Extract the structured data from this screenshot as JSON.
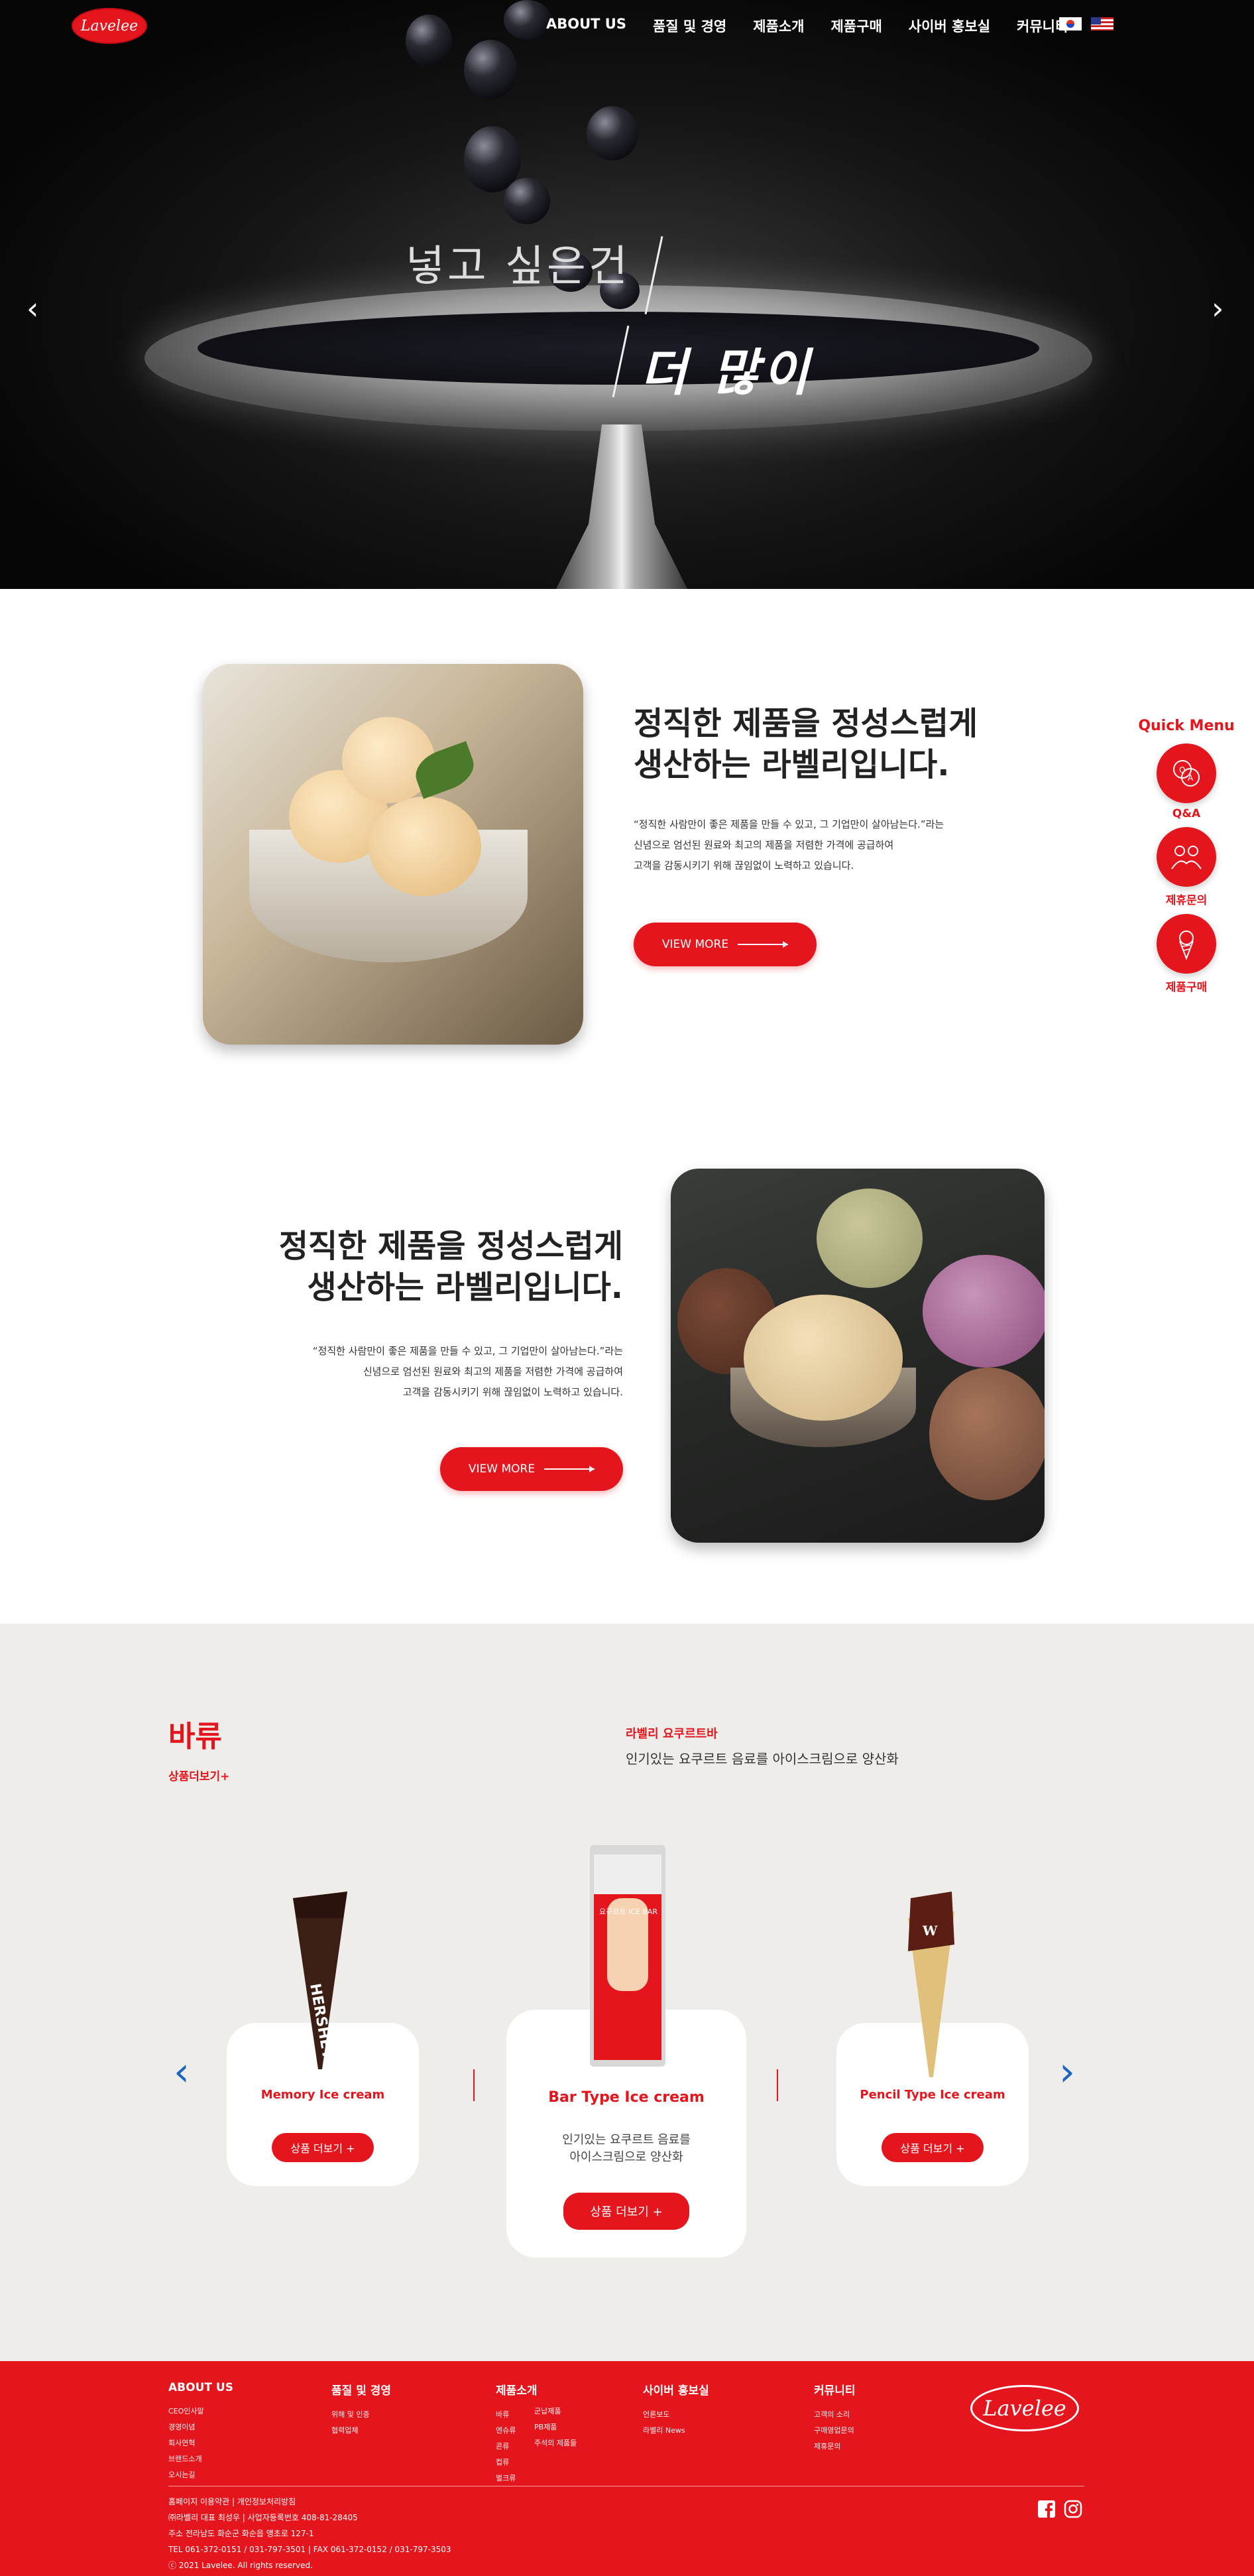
{
  "header": {
    "logo": "Lavelee",
    "nav": [
      "ABOUT US",
      "품질 및 경영",
      "제품소개",
      "제품구매",
      "사이버 홍보실",
      "커뮤니티"
    ],
    "flags": [
      "kr-flag-icon",
      "us-flag-icon"
    ]
  },
  "hero": {
    "line1": "넣고 싶은건",
    "line2": "더 많이",
    "prev_icon": "chevron-left-icon",
    "next_icon": "chevron-right-icon"
  },
  "intro1": {
    "title_l1": "정직한 제품을 정성스럽게",
    "title_l2": "생산하는 라벨리입니다.",
    "desc_l1": "“정직한 사람만이 좋은 제품을 만들 수 있고, 그 기업만이 살아남는다.”라는",
    "desc_l2": "신념으로 엄선된 원료와 최고의 제품을 저렴한 가격에 공급하여",
    "desc_l3": "고객을 감동시키기 위해 끊임없이 노력하고 있습니다.",
    "button": "VIEW MORE"
  },
  "intro2": {
    "title_l1": "정직한 제품을 정성스럽게",
    "title_l2": "생산하는 라벨리입니다.",
    "desc_l1": "“정직한 사람만이 좋은 제품을 만들 수 있고, 그 기업만이 살아남는다.”라는",
    "desc_l2": "신념으로 엄선된 원료와 최고의 제품을 저렴한 가격에 공급하여",
    "desc_l3": "고객을 감동시키기 위해 끊임없이 노력하고 있습니다.",
    "button": "VIEW MORE"
  },
  "quick_menu": {
    "title": "Quick Menu",
    "items": [
      {
        "label": "Q&A",
        "icon": "qa-icon"
      },
      {
        "label": "제휴문의",
        "icon": "partnership-icon"
      },
      {
        "label": "제품구매",
        "icon": "ice-cream-icon"
      }
    ]
  },
  "products": {
    "brand": "바류",
    "more": "상품더보기+",
    "featured_name": "라벨리 요쿠르트바",
    "featured_desc": "인기있는 요쿠르트 음료를 아이스크림으로 양산화",
    "cards": [
      {
        "name": "Memory Ice cream",
        "button": "상품 더보기 +"
      },
      {
        "name": "Bar Type Ice cream",
        "desc_l1": "인기있는 요쿠르트 음료를",
        "desc_l2": "아이스크림으로 양산화",
        "button": "상품 더보기 +"
      },
      {
        "name": "Pencil Type Ice cream",
        "button": "상품 더보기 +"
      }
    ],
    "package_text": "요구르트 ICE BAR"
  },
  "footer": {
    "cols": [
      {
        "head": "ABOUT US",
        "items": [
          "CEO인사말",
          "경영이념",
          "회사연혁",
          "브랜드소개",
          "오시는길"
        ]
      },
      {
        "head": "품질 및 경영",
        "items": [
          "위해 및 인증",
          "협력업체"
        ]
      },
      {
        "head": "제품소개",
        "items": [
          "바류",
          "엔슈류",
          "콘류",
          "컵류",
          "벌크류"
        ]
      },
      {
        "head": "",
        "items": [
          "군납제품",
          "PB제품",
          "주석의 제품들"
        ]
      },
      {
        "head": "사이버 홍보실",
        "items": [
          "언론보도",
          "라벨리 News"
        ]
      },
      {
        "head": "커뮤니티",
        "items": [
          "고객의 소리",
          "구매영업문의",
          "제휴문의"
        ]
      }
    ],
    "logo": "Lavelee",
    "info": [
      "홈페이지 이용약관 | 개인정보처리방침",
      "㈜라벨리 대표 최성우 | 사업자등록번호 408-81-28405",
      "주소 전라남도 화순군 화순읍 앵초로 127-1",
      "TEL 061-372-0151 / 031-797-3501 | FAX 061-372-0152 / 031-797-3503",
      "ⓒ 2021 Lavelee. All rights reserved."
    ],
    "social": [
      "facebook-icon",
      "instagram-icon"
    ]
  }
}
